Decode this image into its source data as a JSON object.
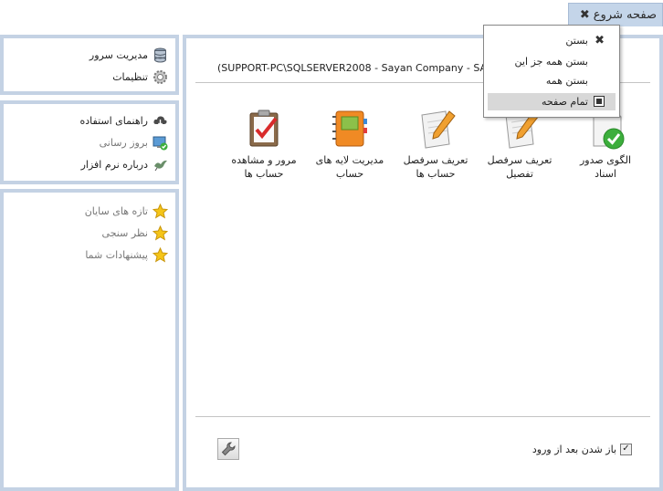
{
  "tab": {
    "title": "صفحه شروع"
  },
  "context_menu": {
    "items": [
      {
        "label": "بستن"
      },
      {
        "label": "بستن همه جز این"
      },
      {
        "label": "بستن همه"
      },
      {
        "label": "تمام صفحه"
      }
    ]
  },
  "sidebar": {
    "group1": [
      {
        "label": "مدیریت سرور"
      },
      {
        "label": "تنظیمات"
      }
    ],
    "group2": [
      {
        "label": "راهنمای استفاده"
      },
      {
        "label": "بروز رسانی"
      },
      {
        "label": "درباره نرم افزار"
      }
    ],
    "group3": [
      {
        "label": "تازه های سایان"
      },
      {
        "label": "نظر سنجی"
      },
      {
        "label": "پیشنهادات شما"
      }
    ]
  },
  "main": {
    "connection": "(SUPPORT-PC\\SQLSERVER2008 - Sayan Company - SA",
    "connection_tail": "pany",
    "tiles": [
      {
        "line1": "الگوی صدور",
        "line2": "اسناد"
      },
      {
        "line1": "تعریف سرفصل",
        "line2": "تفصیل"
      },
      {
        "line1": "تعریف سرفصل",
        "line2": "حساب ها"
      },
      {
        "line1": "مدیریت لایه های",
        "line2": "حساب"
      },
      {
        "line1": "مرور و مشاهده",
        "line2": "حساب ها"
      }
    ],
    "startup_label": "باز شدن بعد از ورود",
    "startup_checked": true
  },
  "colors": {
    "panel_border": "#c4d2e4",
    "tab_bg": "#c4d5e9",
    "menu_highlight": "#d8d8d8"
  }
}
